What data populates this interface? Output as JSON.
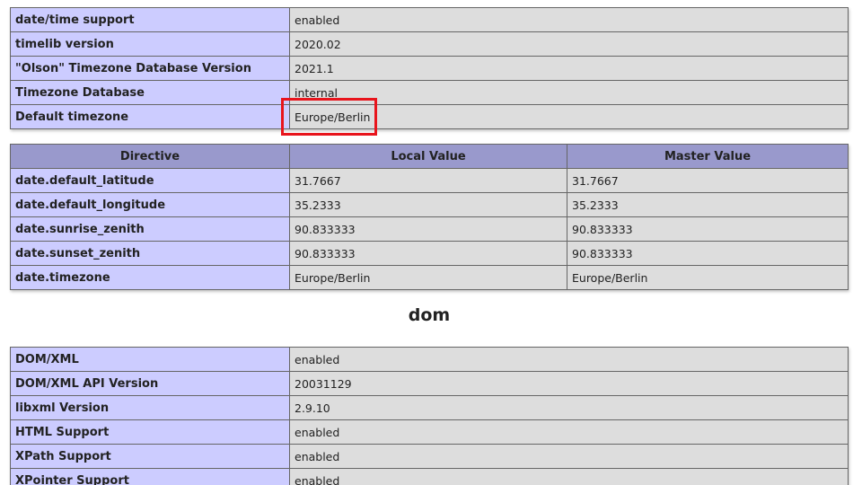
{
  "date_support": {
    "rows": [
      {
        "name": "date/time support",
        "value": "enabled"
      },
      {
        "name": "timelib version",
        "value": "2020.02"
      },
      {
        "name": "\"Olson\" Timezone Database Version",
        "value": "2021.1"
      },
      {
        "name": "Timezone Database",
        "value": "internal"
      },
      {
        "name": "Default timezone",
        "value": "Europe/Berlin"
      }
    ]
  },
  "date_directives": {
    "headers": {
      "directive": "Directive",
      "local": "Local Value",
      "master": "Master Value"
    },
    "rows": [
      {
        "name": "date.default_latitude",
        "local": "31.7667",
        "master": "31.7667"
      },
      {
        "name": "date.default_longitude",
        "local": "35.2333",
        "master": "35.2333"
      },
      {
        "name": "date.sunrise_zenith",
        "local": "90.833333",
        "master": "90.833333"
      },
      {
        "name": "date.sunset_zenith",
        "local": "90.833333",
        "master": "90.833333"
      },
      {
        "name": "date.timezone",
        "local": "Europe/Berlin",
        "master": "Europe/Berlin"
      }
    ]
  },
  "dom_section": {
    "title": "dom",
    "rows": [
      {
        "name": "DOM/XML",
        "value": "enabled"
      },
      {
        "name": "DOM/XML API Version",
        "value": "20031129"
      },
      {
        "name": "libxml Version",
        "value": "2.9.10"
      },
      {
        "name": "HTML Support",
        "value": "enabled"
      },
      {
        "name": "XPath Support",
        "value": "enabled"
      },
      {
        "name": "XPointer Support",
        "value": "enabled"
      }
    ]
  },
  "colors": {
    "label_cell": "#ccccff",
    "value_cell": "#dddddd",
    "header_row": "#9999cc",
    "highlight": "#e8141c"
  }
}
